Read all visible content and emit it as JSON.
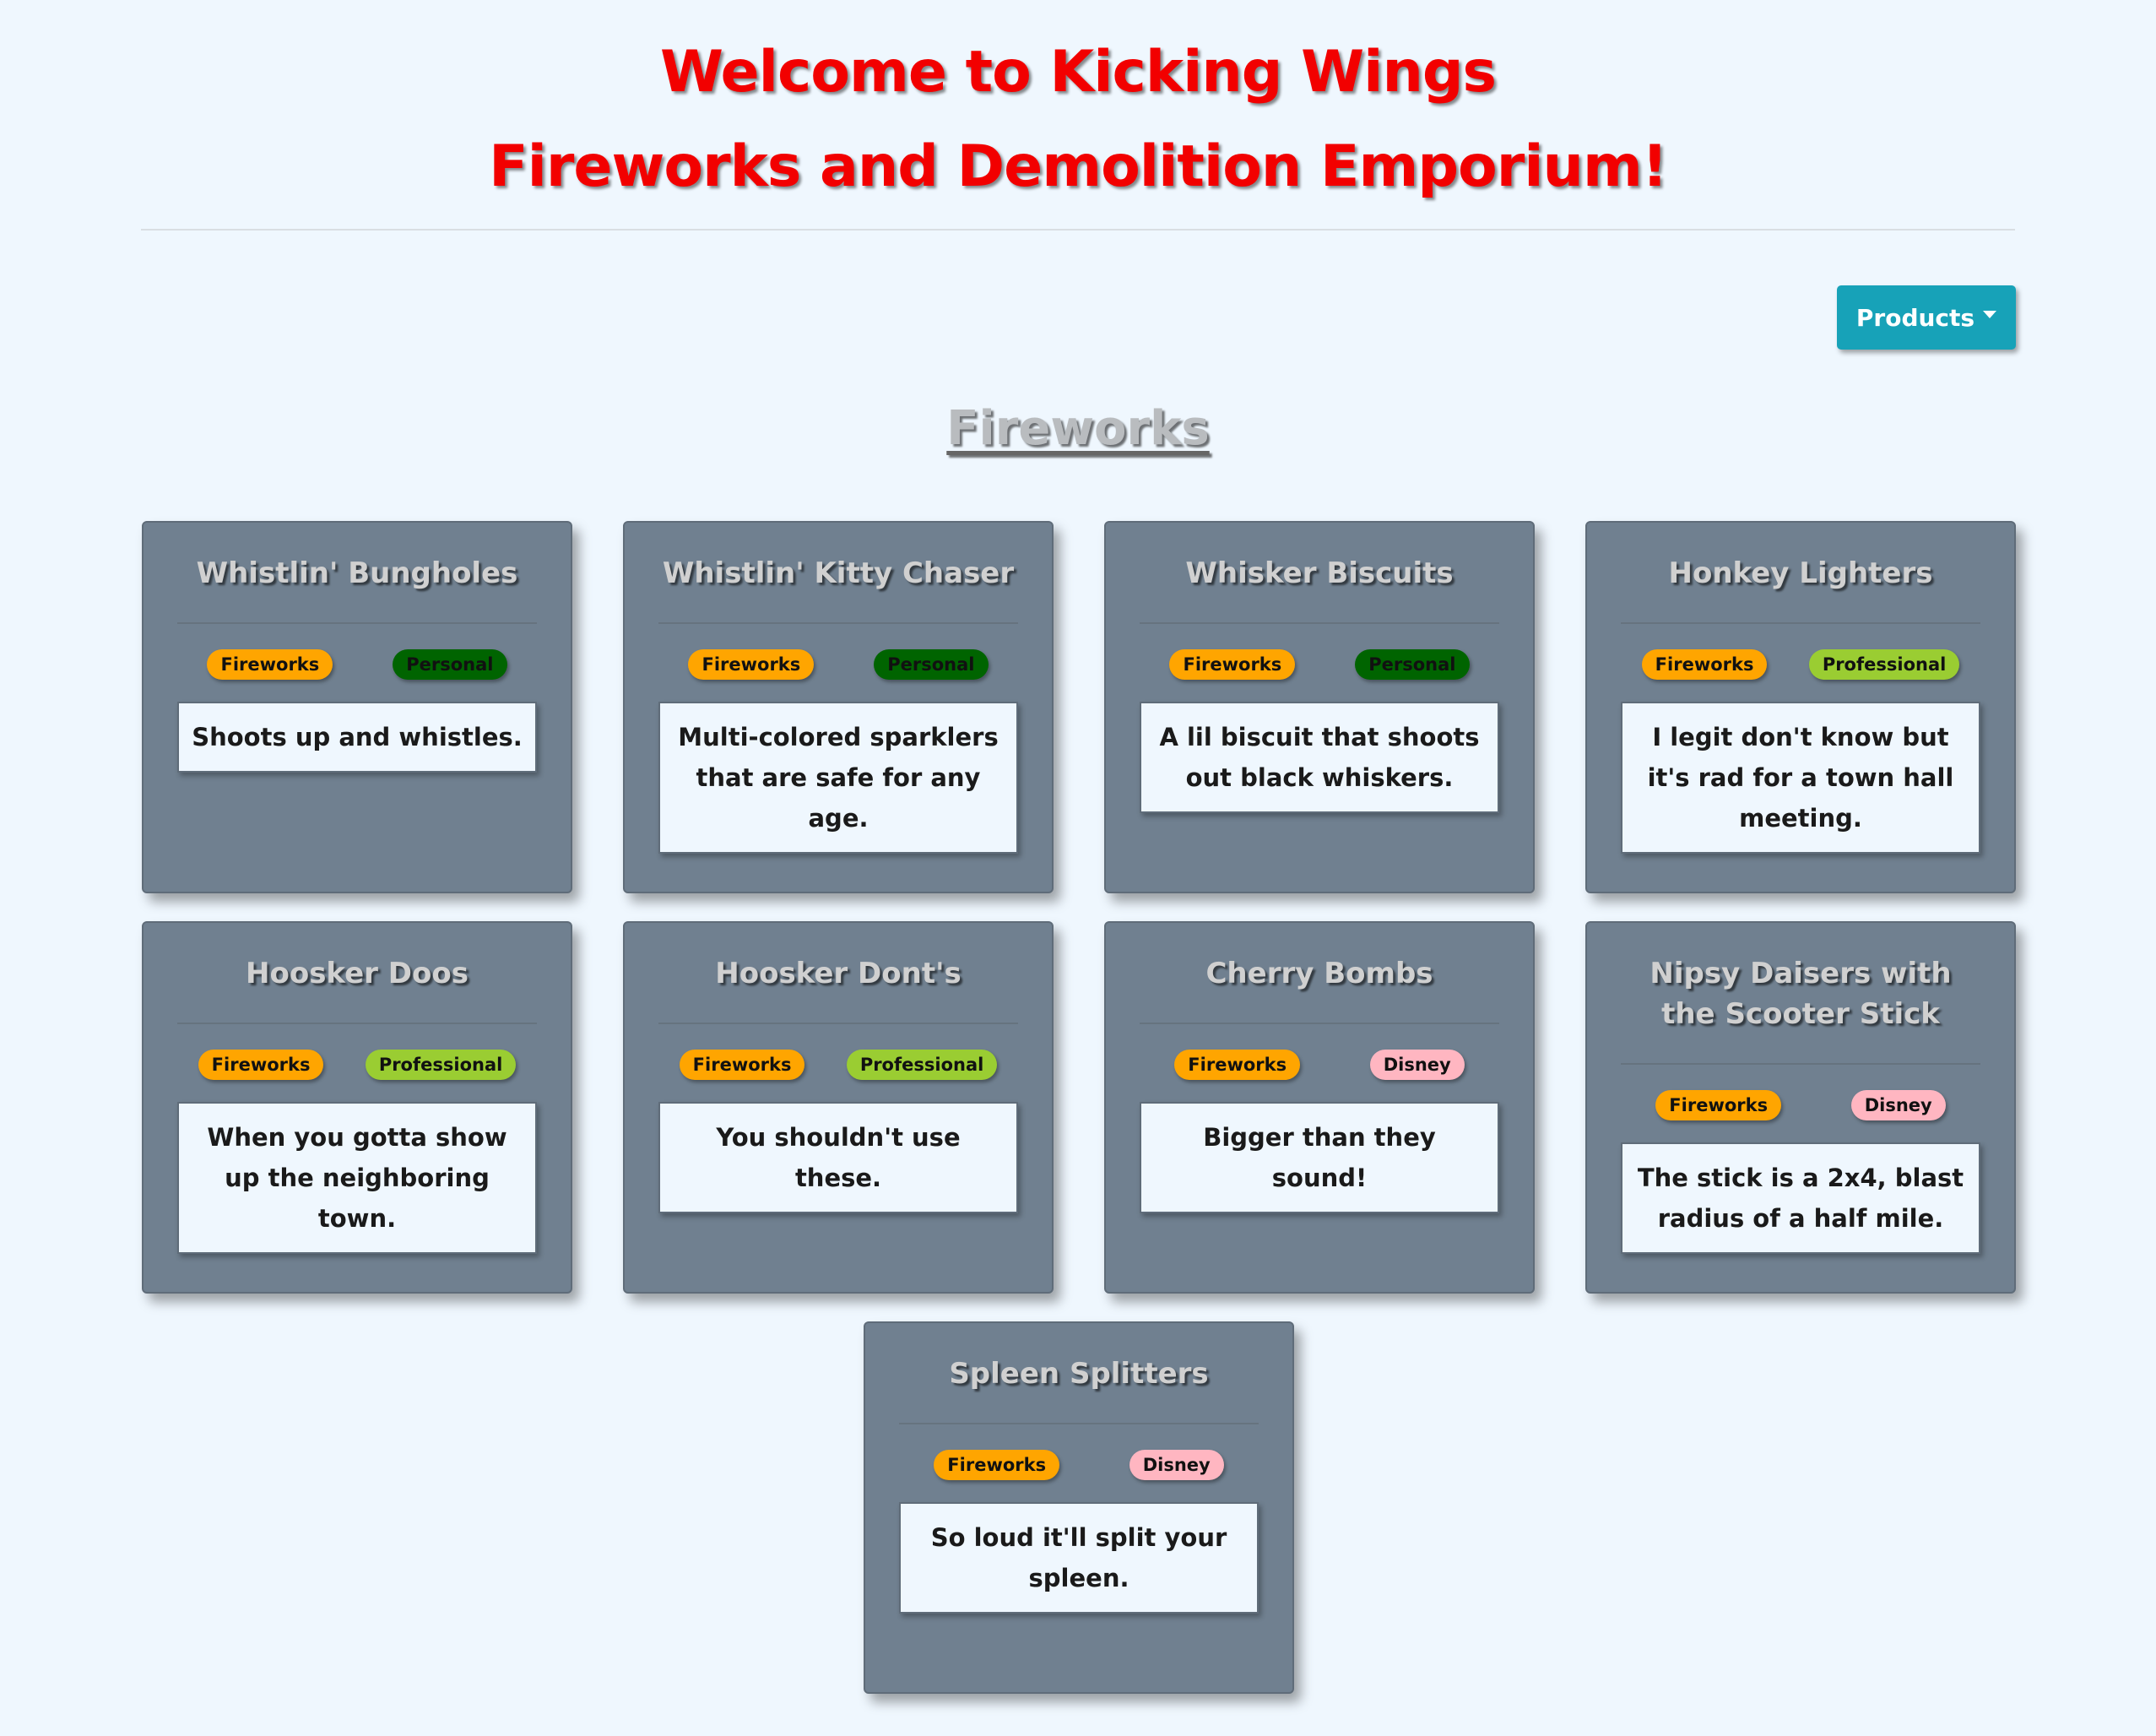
{
  "header": {
    "line1": "Welcome to Kicking Wings",
    "line2": "Fireworks and Demolition Emporium!"
  },
  "nav": {
    "products_label": "Products"
  },
  "section": {
    "title": "Fireworks"
  },
  "colors": {
    "background": "#eff7fe",
    "title_red": "#f20000",
    "card": "#708090",
    "button": "#17a2b8",
    "badge_fireworks": "#ffa500",
    "badge_personal": "#006400",
    "badge_professional": "#9acd32",
    "badge_disney": "#ffb6c1"
  },
  "products": [
    {
      "name": "Whistlin' Bungholes",
      "category": "Fireworks",
      "tier": "Personal",
      "description": "Shoots up and whistles."
    },
    {
      "name": "Whistlin' Kitty Chaser",
      "category": "Fireworks",
      "tier": "Personal",
      "description": "Multi-colored sparklers that are safe for any age."
    },
    {
      "name": "Whisker Biscuits",
      "category": "Fireworks",
      "tier": "Personal",
      "description": "A lil biscuit that shoots out black whiskers."
    },
    {
      "name": "Honkey Lighters",
      "category": "Fireworks",
      "tier": "Professional",
      "description": "I legit don't know but it's rad for a town hall meeting."
    },
    {
      "name": "Hoosker Doos",
      "category": "Fireworks",
      "tier": "Professional",
      "description": "When you gotta show up the neighboring town."
    },
    {
      "name": "Hoosker Dont's",
      "category": "Fireworks",
      "tier": "Professional",
      "description": "You shouldn't use these."
    },
    {
      "name": "Cherry Bombs",
      "category": "Fireworks",
      "tier": "Disney",
      "description": "Bigger than they sound!"
    },
    {
      "name": "Nipsy Daisers with the Scooter Stick",
      "category": "Fireworks",
      "tier": "Disney",
      "description": "The stick is a 2x4, blast radius of a half mile."
    },
    {
      "name": "Spleen Splitters",
      "category": "Fireworks",
      "tier": "Disney",
      "description": "So loud it'll split your spleen."
    }
  ]
}
